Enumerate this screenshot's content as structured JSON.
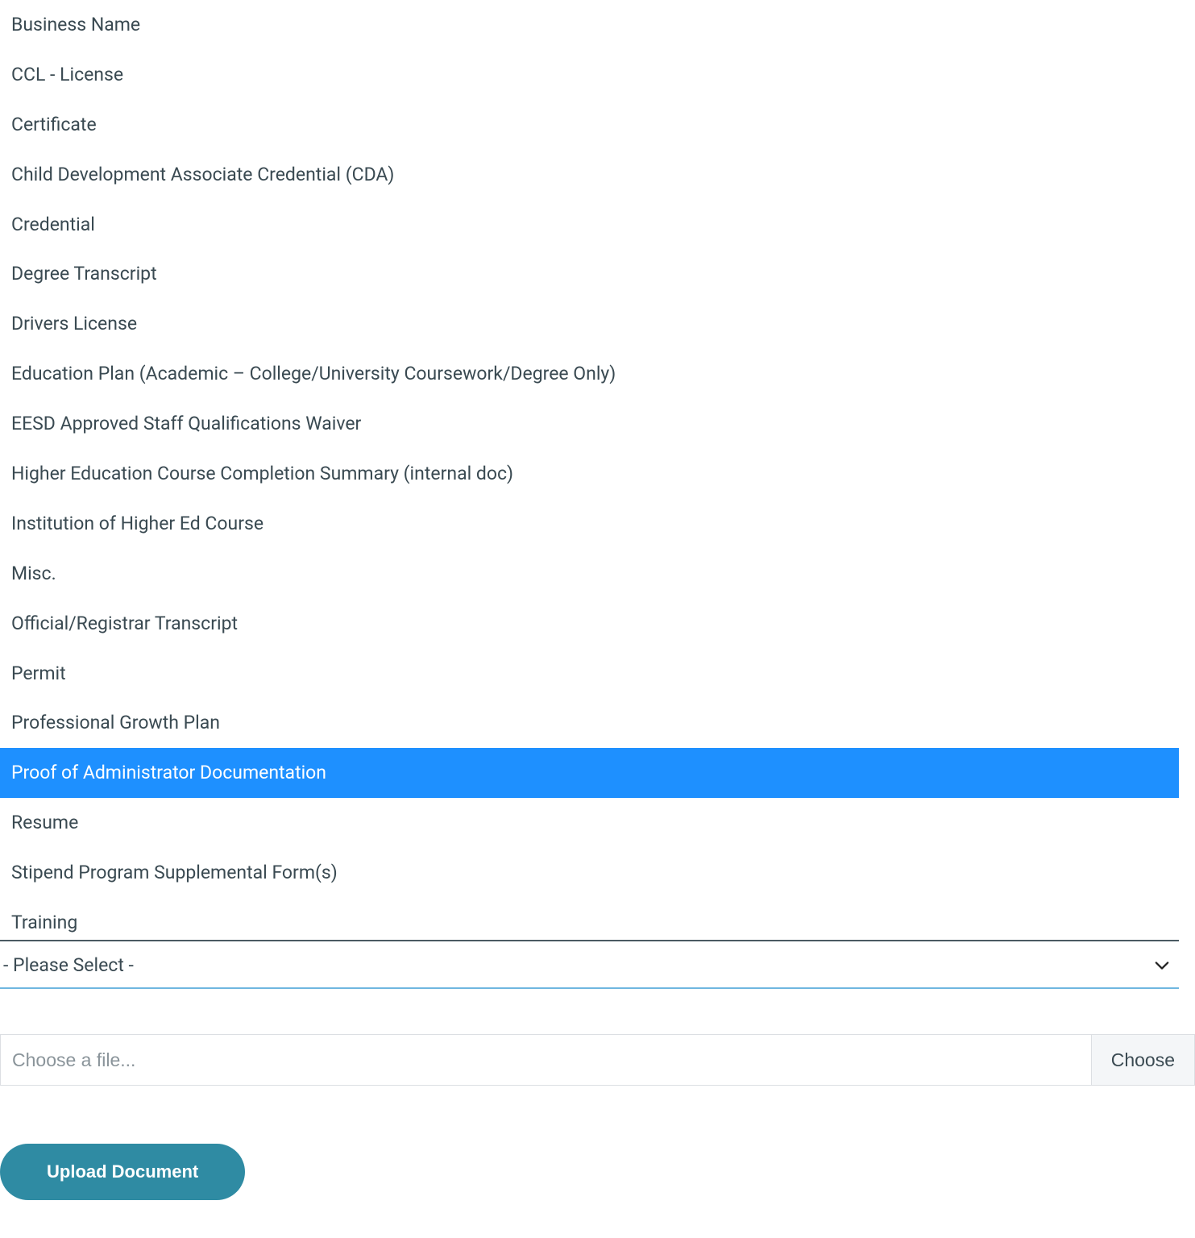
{
  "dropdown": {
    "items": [
      {
        "label": "Business Name",
        "selected": false
      },
      {
        "label": "CCL - License",
        "selected": false
      },
      {
        "label": "Certificate",
        "selected": false
      },
      {
        "label": "Child Development Associate Credential (CDA)",
        "selected": false
      },
      {
        "label": "Credential",
        "selected": false
      },
      {
        "label": "Degree Transcript",
        "selected": false
      },
      {
        "label": "Drivers License",
        "selected": false
      },
      {
        "label": "Education Plan (Academic – College/University Coursework/Degree Only)",
        "selected": false
      },
      {
        "label": "EESD Approved Staff Qualifications Waiver",
        "selected": false
      },
      {
        "label": "Higher Education Course Completion Summary (internal doc)",
        "selected": false
      },
      {
        "label": "Institution of Higher Ed Course",
        "selected": false
      },
      {
        "label": "Misc.",
        "selected": false
      },
      {
        "label": "Official/Registrar Transcript",
        "selected": false
      },
      {
        "label": "Permit",
        "selected": false
      },
      {
        "label": "Professional Growth Plan",
        "selected": false
      },
      {
        "label": "Proof of Administrator Documentation",
        "selected": true
      },
      {
        "label": "Resume",
        "selected": false
      },
      {
        "label": "Stipend Program Supplemental Form(s)",
        "selected": false
      },
      {
        "label": "Training",
        "selected": false
      }
    ]
  },
  "select": {
    "placeholder": "- Please Select -"
  },
  "file": {
    "placeholder": "Choose a file...",
    "choose_label": "Choose"
  },
  "upload_label": "Upload Document",
  "colors": {
    "highlight": "#1e90ff",
    "accent": "#2f8ba3",
    "underline": "#6fb7e0"
  }
}
